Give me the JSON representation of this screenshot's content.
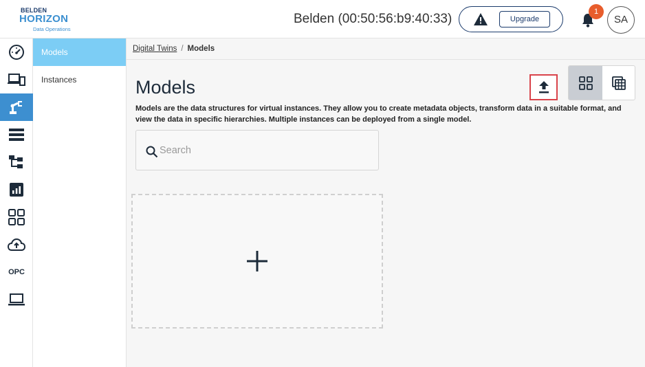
{
  "header": {
    "logo": {
      "line1": "BELDEN",
      "line2": "HORIZON",
      "line3": "Data Operations"
    },
    "device_title": "Belden (00:50:56:b9:40:33)",
    "upgrade_label": "Upgrade",
    "notification_count": "1",
    "avatar_initials": "SA"
  },
  "rail": {
    "items": [
      {
        "icon": "dashboard-gauge-icon"
      },
      {
        "icon": "devices-icon"
      },
      {
        "icon": "robot-arm-icon",
        "active": true
      },
      {
        "icon": "list-icon"
      },
      {
        "icon": "hierarchy-icon"
      },
      {
        "icon": "report-chart-icon"
      },
      {
        "icon": "apps-grid-icon"
      },
      {
        "icon": "cloud-upload-icon"
      },
      {
        "icon": "opc-icon",
        "label": "OPC"
      },
      {
        "icon": "laptop-icon"
      }
    ]
  },
  "subnav": {
    "items": [
      {
        "label": "Models",
        "active": true
      },
      {
        "label": "Instances"
      }
    ]
  },
  "breadcrumb": {
    "parent": "Digital Twins",
    "separator": "/",
    "current": "Models"
  },
  "main": {
    "title": "Models",
    "description": "Models are the data structures for virtual instances. They allow you to create metadata objects, transform data in a suitable format, and view the data in specific hierarchies. Multiple instances can be deployed from a single model.",
    "search": {
      "placeholder": "Search",
      "value": ""
    },
    "add_card_symbol": "+"
  },
  "colors": {
    "accent": "#3d8fd0",
    "subnav_active": "#7ccdf5",
    "badge": "#e85d2c",
    "highlight_border": "#d9434a",
    "text_dark": "#1d2b3a"
  }
}
